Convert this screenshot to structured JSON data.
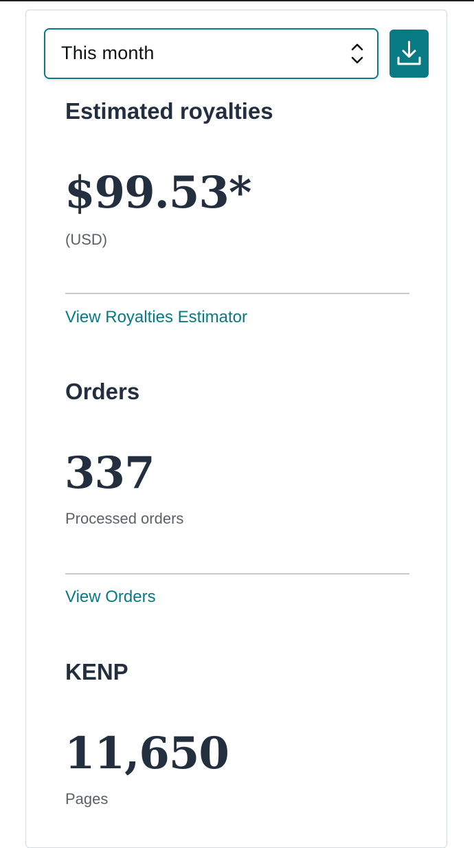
{
  "filter": {
    "selected": "This month"
  },
  "download": {
    "icon": "download-icon"
  },
  "royalties": {
    "title": "Estimated royalties",
    "amount": "$99.53*",
    "currency": "(USD)",
    "link": "View Royalties Estimator"
  },
  "orders": {
    "title": "Orders",
    "count": "337",
    "label": "Processed orders",
    "link": "View Orders"
  },
  "kenp": {
    "title": "KENP",
    "count": "11,650",
    "label": "Pages"
  },
  "colors": {
    "accent": "#077a83",
    "heading": "#232f3e",
    "muted": "#5a6166"
  }
}
